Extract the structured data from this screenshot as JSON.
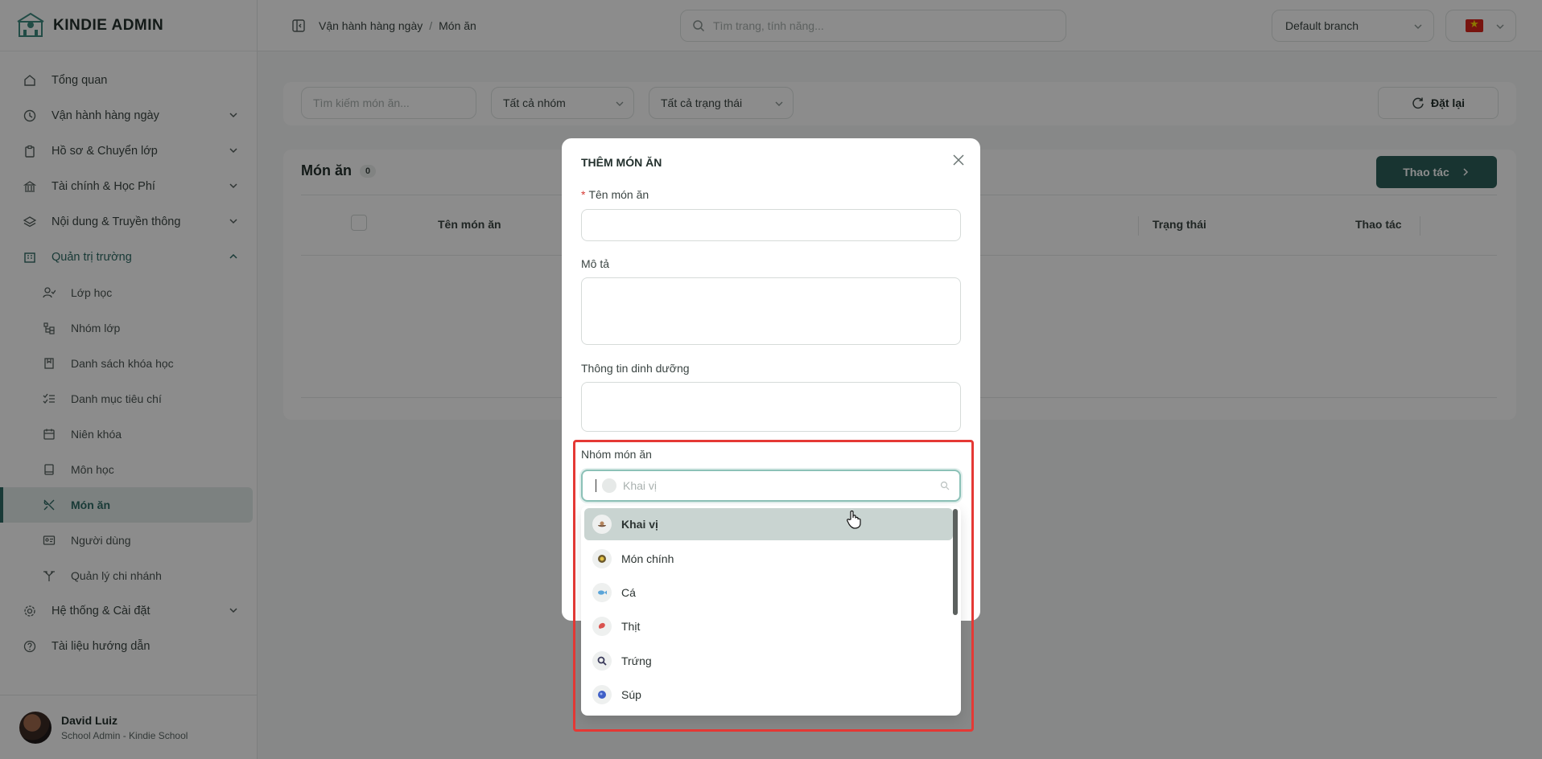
{
  "brand": {
    "name": "KINDIE ADMIN"
  },
  "nav": {
    "items": [
      {
        "label": "Tổng quan",
        "icon": "home-icon"
      },
      {
        "label": "Vận hành hàng ngày",
        "icon": "clock-icon"
      },
      {
        "label": "Hồ sơ & Chuyển lớp",
        "icon": "clipboard-icon"
      },
      {
        "label": "Tài chính & Học Phí",
        "icon": "bank-icon"
      },
      {
        "label": "Nội dung & Truyền thông",
        "icon": "layers-icon"
      },
      {
        "label": "Quản trị trường",
        "icon": "building-icon"
      }
    ],
    "sub_items": [
      {
        "label": "Lớp học",
        "icon": "user-check-icon"
      },
      {
        "label": "Nhóm lớp",
        "icon": "tree-icon"
      },
      {
        "label": "Danh sách khóa học",
        "icon": "book-icon"
      },
      {
        "label": "Danh mục tiêu chí",
        "icon": "checklist-icon"
      },
      {
        "label": "Niên khóa",
        "icon": "calendar-icon"
      },
      {
        "label": "Môn học",
        "icon": "notebook-icon"
      },
      {
        "label": "Món ăn",
        "icon": "utensils-icon"
      },
      {
        "label": "Người dùng",
        "icon": "id-card-icon"
      },
      {
        "label": "Quản lý chi nhánh",
        "icon": "branch-icon"
      }
    ],
    "bottom_items": [
      {
        "label": "Hệ thống & Cài đặt",
        "icon": "gear-icon"
      },
      {
        "label": "Tài liệu hướng dẫn",
        "icon": "help-icon"
      }
    ]
  },
  "user": {
    "name": "David Luiz",
    "role": "School Admin - Kindie School"
  },
  "header": {
    "breadcrumb": [
      "Vận hành hàng ngày",
      "Món ăn"
    ],
    "breadcrumb_sep": "/",
    "search_placeholder": "Tìm trang, tính năng...",
    "branch": "Default branch"
  },
  "filters": {
    "search_placeholder": "Tìm kiếm món ăn...",
    "group_select": "Tất cả nhóm",
    "status_select": "Tất cả trạng thái",
    "reset_label": "Đặt lại"
  },
  "list": {
    "title": "Món ăn",
    "count": "0",
    "action_label": "Thao tác",
    "columns": [
      "Tên món ăn",
      "Trạng thái",
      "Thao tác"
    ]
  },
  "modal": {
    "title": "THÊM MÓN ĂN",
    "name_label": "Tên món ăn",
    "required_mark": "*",
    "desc_label": "Mô tả",
    "nutrition_label": "Thông tin dinh dưỡng",
    "group_label": "Nhóm món ăn",
    "group_placeholder": "Khai vị",
    "options": [
      "Khai vị",
      "Món chính",
      "Cá",
      "Thịt",
      "Trứng",
      "Súp"
    ],
    "option_icons": [
      "appetizer-icon",
      "main-dish-icon",
      "fish-icon",
      "meat-icon",
      "egg-icon",
      "soup-icon"
    ]
  },
  "colors": {
    "accent": "#2c5f5a",
    "highlight": "#e53935"
  }
}
